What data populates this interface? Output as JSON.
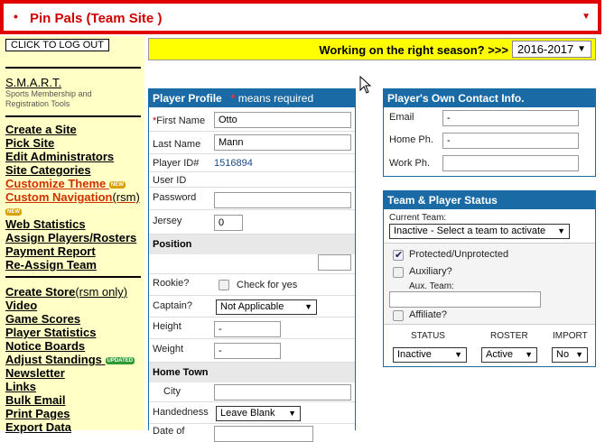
{
  "site_selector": {
    "bullet": "•",
    "label": "Pin Pals (Team Site )",
    "arrow": "▼"
  },
  "sidebar": {
    "logout_label": "CLICK TO LOG OUT",
    "smart_title": "S.M.A.R.T.",
    "smart_subtitle": "Sports Membership and Registration Tools",
    "nav_group1": [
      {
        "label": "Create a Site"
      },
      {
        "label": "Pick Site"
      },
      {
        "label": "Edit Administrators"
      },
      {
        "label": "Site Categories"
      },
      {
        "label": "Customize Theme",
        "badge": "NEW"
      },
      {
        "label": "Custom Navigation",
        "suffix": "(rsm)",
        "badge": "NEW"
      },
      {
        "label": "Web Statistics"
      },
      {
        "label": "Assign Players/Rosters"
      },
      {
        "label": "Payment Report"
      },
      {
        "label": "Re-Assign Team"
      }
    ],
    "nav_group2": [
      {
        "label": "Create Store",
        "suffix": "(rsm only)"
      },
      {
        "label": "Video"
      },
      {
        "label": "Game Scores"
      },
      {
        "label": "Player Statistics"
      },
      {
        "label": "Notice Boards"
      },
      {
        "label": "Adjust Standings",
        "badge": "UPDATED"
      },
      {
        "label": "Newsletter"
      },
      {
        "label": "Links"
      },
      {
        "label": "Bulk Email"
      },
      {
        "label": "Print Pages"
      },
      {
        "label": "Export Data"
      }
    ]
  },
  "season_bar": {
    "question": "Working on the right season? >>>",
    "selected": "2016-2017",
    "arrow": "▼"
  },
  "player_profile": {
    "title": "Player Profile",
    "required_star": "*",
    "required_note": "means required",
    "first_name_label": "First Name",
    "first_name_star": "*",
    "first_name": "Otto",
    "last_name_label": "Last Name",
    "last_name": "Mann",
    "player_id_label": "Player ID#",
    "player_id": "1516894",
    "user_id_label": "User ID",
    "password_label": "Password",
    "jersey_label": "Jersey",
    "jersey": "0",
    "position_header": "Position",
    "rookie_label": "Rookie?",
    "rookie_check_label": "Check for yes",
    "captain_label": "Captain?",
    "captain_value": "Not Applicable",
    "height_label": "Height",
    "height_value": "-",
    "weight_label": "Weight",
    "weight_value": "-",
    "home_town_header": "Home Town",
    "city_label": "City",
    "handedness_label": "Handedness",
    "handedness_value": "Leave Blank",
    "dob_label": "Date of"
  },
  "contact_info": {
    "title": "Player's Own Contact Info.",
    "email_label": "Email",
    "email_value": "-",
    "home_label": "Home Ph.",
    "home_value": "-",
    "work_label": "Work Ph."
  },
  "team_status": {
    "title": "Team & Player Status",
    "current_team_label": "Current Team:",
    "current_team_value": "Inactive - Select a team to activate",
    "protected_label": "Protected/Unprotected",
    "auxiliary_label": "Auxiliary?",
    "aux_team_label": "Aux. Team:",
    "affiliate_label": "Affiliate?",
    "col_status": "STATUS",
    "col_roster": "ROSTER",
    "col_import": "IMPORT",
    "status_value": "Inactive",
    "roster_value": "Active",
    "import_value": "No"
  }
}
